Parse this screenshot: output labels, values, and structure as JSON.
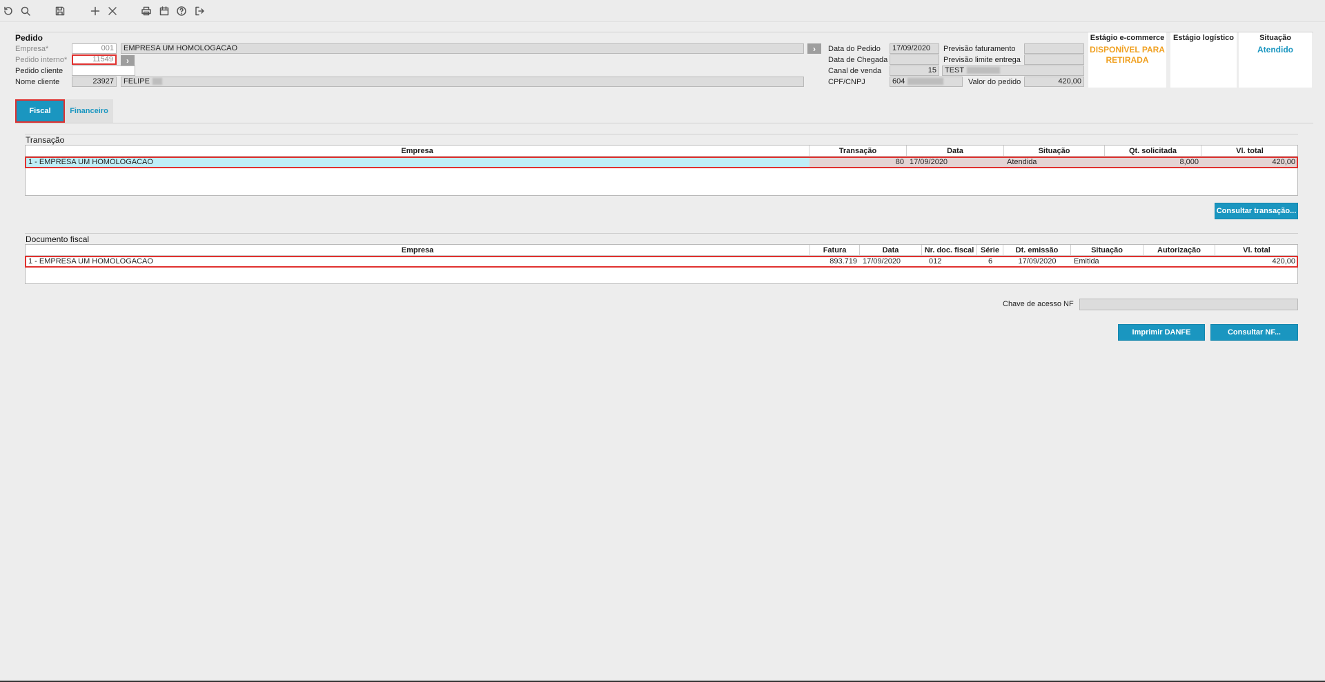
{
  "toolbar": {
    "icons": [
      "undo-icon",
      "search-icon",
      "save-icon",
      "plus-icon",
      "close-icon",
      "print-icon",
      "calendar-icon",
      "help-icon",
      "exit-icon"
    ]
  },
  "header": {
    "title": "Pedido",
    "empresa_label": "Empresa*",
    "empresa_code": "001",
    "empresa_name": "EMPRESA UM HOMOLOGACAO",
    "pedido_interno_label": "Pedido interno*",
    "pedido_interno_value": "11549",
    "pedido_cliente_label": "Pedido cliente",
    "pedido_cliente_value": "",
    "nome_cliente_label": "Nome cliente",
    "nome_cliente_code": "23927",
    "nome_cliente_name": "FELIPE",
    "data_pedido_label": "Data do Pedido",
    "data_pedido_value": "17/09/2020",
    "data_chegada_label": "Data de Chegada",
    "data_chegada_value": "",
    "canal_venda_label": "Canal de venda",
    "canal_venda_code": "15",
    "canal_venda_name": "TEST",
    "cpf_label": "CPF/CNPJ",
    "cpf_value": "604",
    "previsao_fat_label": "Previsão faturamento",
    "previsao_fat_value": "",
    "previsao_lim_label": "Previsão limite entrega",
    "previsao_lim_value": "",
    "valor_pedido_label": "Valor do pedido",
    "valor_pedido_value": "420,00"
  },
  "panels": {
    "ecommerce_title": "Estágio e-commerce",
    "ecommerce_value_line1": "DISPONÍVEL PARA",
    "ecommerce_value_line2": "RETIRADA",
    "logistico_title": "Estágio logístico",
    "situacao_title": "Situação",
    "situacao_value": "Atendido",
    "colors": {
      "ecommerce": "#f0a020",
      "situacao": "#1a96c0"
    }
  },
  "tabs": [
    {
      "label": "Fiscal",
      "active": true
    },
    {
      "label": "Financeiro",
      "active": false
    }
  ],
  "transacao": {
    "title": "Transação",
    "headers": [
      "Empresa",
      "Transação",
      "Data",
      "Situação",
      "Qt. solicitada",
      "Vl. total"
    ],
    "rows": [
      [
        "1 - EMPRESA UM HOMOLOGACAO",
        "80",
        "17/09/2020",
        "Atendida",
        "8,000",
        "420,00"
      ]
    ],
    "button_label": "Consultar transação..."
  },
  "documento": {
    "title": "Documento fiscal",
    "headers": [
      "Empresa",
      "Fatura",
      "Data",
      "Nr. doc. fiscal",
      "Série",
      "Dt. emissão",
      "Situação",
      "Autorização",
      "Vl. total"
    ],
    "rows": [
      [
        "1 - EMPRESA UM HOMOLOGACAO",
        "893.719",
        "17/09/2020",
        "012",
        "6",
        "17/09/2020",
        "Emitida",
        "",
        "420,00"
      ]
    ],
    "chave_label": "Chave de acesso NF",
    "chave_value": "",
    "btn_danfe": "Imprimir DANFE",
    "btn_nf": "Consultar NF..."
  }
}
